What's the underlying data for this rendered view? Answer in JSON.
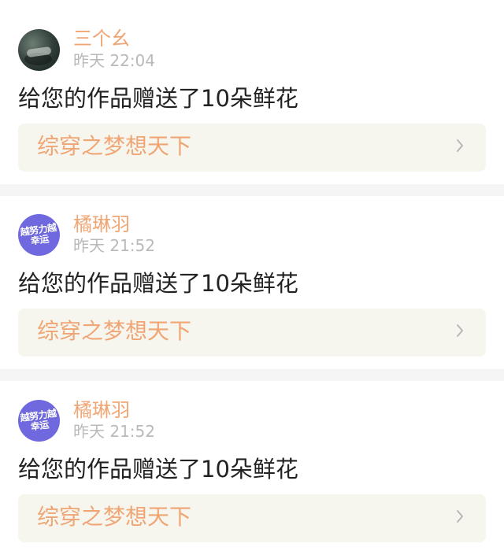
{
  "notifications": [
    {
      "username": "三个幺",
      "time": "昨天 22:04",
      "message": "给您的作品赠送了10朵鲜花",
      "work_title": "综穿之梦想天下",
      "avatar_icon": "photo-avatar"
    },
    {
      "username": "橘琳羽",
      "time": "昨天 21:52",
      "message": "给您的作品赠送了10朵鲜花",
      "work_title": "综穿之梦想天下",
      "avatar_icon": "logo-avatar",
      "avatar_text": "越努力越幸运"
    },
    {
      "username": "橘琳羽",
      "time": "昨天 21:52",
      "message": "给您的作品赠送了10朵鲜花",
      "work_title": "综穿之梦想天下",
      "avatar_icon": "logo-avatar",
      "avatar_text": "越努力越幸运"
    }
  ],
  "colors": {
    "accent": "#f0a674",
    "time": "#b9b9b9",
    "message": "#222222",
    "card_link_bg": "#f6f6ef",
    "divider": "#f5f5f5",
    "tab_indicator": "#f08aa8",
    "avatar_logo_bg": "#6f68df"
  }
}
